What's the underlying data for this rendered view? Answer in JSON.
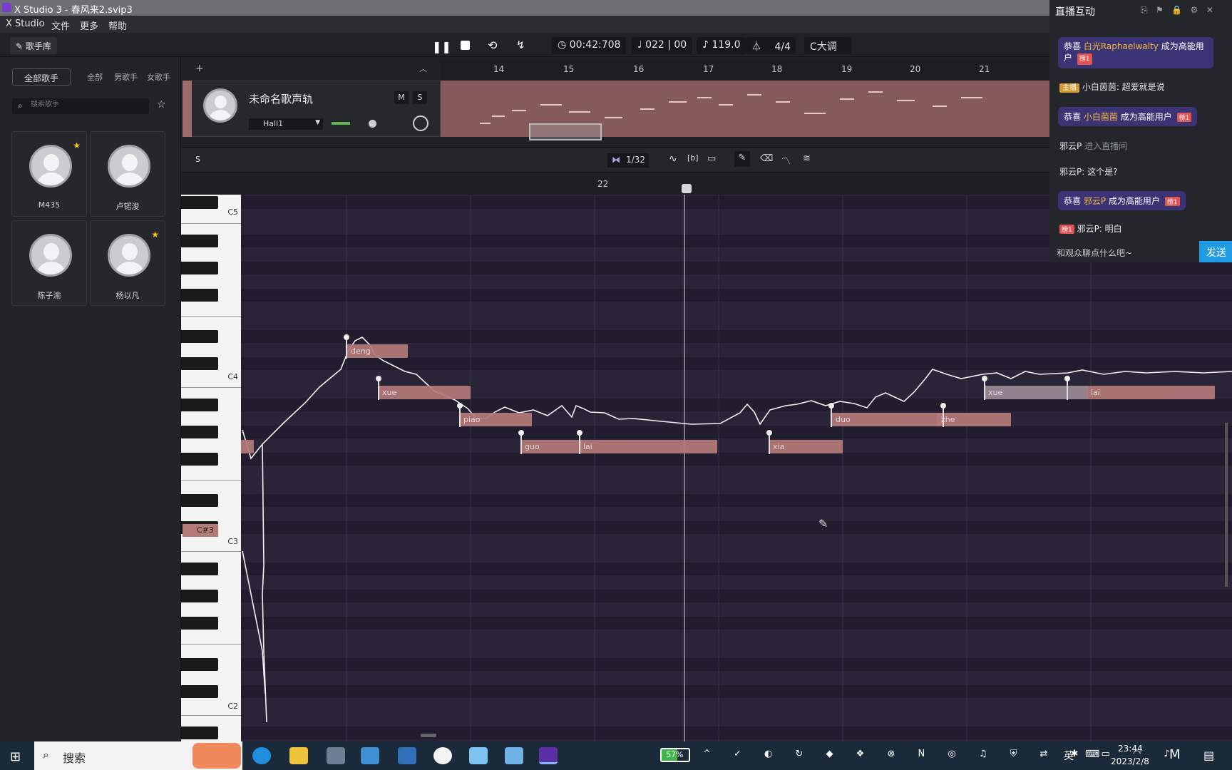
{
  "window": {
    "title": "X Studio 3 - 春风来2.svip3"
  },
  "menu": [
    "X Studio",
    "文件",
    "更多",
    "帮助"
  ],
  "toolbar": {
    "singer_lib": "歌手库",
    "time": "00:42:708",
    "position": "022 | 00",
    "tempo": "119.0",
    "timesig": "4/4",
    "key": "C大调"
  },
  "sidebar": {
    "all_singers": "全部歌手",
    "tabs": [
      "全部",
      "男歌手",
      "女歌手"
    ],
    "search_placeholder": "搜索歌手",
    "singers": [
      {
        "name": "M435",
        "starred": true
      },
      {
        "name": "卢锘浚",
        "starred": false
      },
      {
        "name": "陈子渝",
        "starred": false
      },
      {
        "name": "杨以凡",
        "starred": true
      }
    ]
  },
  "track": {
    "name": "未命名歌声轨",
    "mute": "M",
    "solo": "S",
    "reverb": "Hall1",
    "bars": [
      "14",
      "15",
      "16",
      "17",
      "18",
      "19",
      "20",
      "21"
    ]
  },
  "editor": {
    "s_button": "S",
    "quantize": "1/32",
    "ruler_bar": "22",
    "notes": [
      {
        "lyric": "deng"
      },
      {
        "lyric": "xue"
      },
      {
        "lyric": "piao"
      },
      {
        "lyric": "guo"
      },
      {
        "lyric": "lai"
      },
      {
        "lyric": "xia"
      },
      {
        "lyric": "duo"
      },
      {
        "lyric": "zhe"
      },
      {
        "lyric": "xue"
      },
      {
        "lyric": "lai"
      }
    ],
    "octave_labels": [
      "C5",
      "C4",
      "C3",
      "C2"
    ],
    "hover_key": "C#3"
  },
  "chat": {
    "title": "直播互动",
    "messages": [
      {
        "type": "congrats",
        "prefix": "恭喜",
        "user": "白光Raphaelwalty",
        "suffix": "成为高能用户",
        "level": "榜1"
      },
      {
        "type": "host",
        "badge": "主播",
        "text": "小白茵茵: 超爱就是说"
      },
      {
        "type": "congrats",
        "prefix": "恭喜",
        "user": "小白菌菌",
        "suffix": "成为高能用户",
        "level": "榜1"
      },
      {
        "type": "enter",
        "user": "邪云P",
        "text": "进入直播间"
      },
      {
        "type": "text",
        "text": "邪云P: 这个是?"
      },
      {
        "type": "congrats",
        "prefix": "恭喜",
        "user": "邪云P",
        "suffix": "成为高能用户",
        "level": "榜1"
      },
      {
        "type": "leveltext",
        "level": "榜1",
        "text": "邪云P: 明白"
      }
    ],
    "input_placeholder": "和观众聊点什么吧~",
    "send": "发送"
  },
  "taskbar": {
    "search": "搜索",
    "battery": "57%",
    "ime": "英",
    "time": "23:44",
    "date": "2023/2/8"
  }
}
